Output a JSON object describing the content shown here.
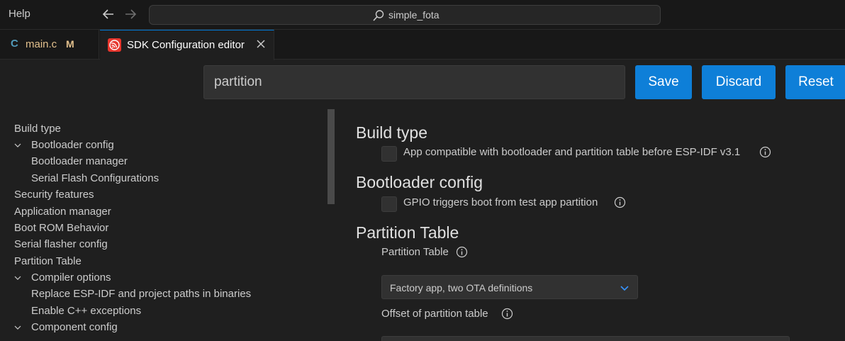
{
  "titlebar": {
    "menu_help": "Help",
    "command_center": "simple_fota"
  },
  "tabs": [
    {
      "lang_badge": "C",
      "label": "main.c",
      "status": "M"
    },
    {
      "label": "SDK Configuration editor"
    }
  ],
  "toolbar": {
    "search_value": "partition",
    "save_label": "Save",
    "discard_label": "Discard",
    "reset_label": "Reset"
  },
  "sidebar": {
    "items": [
      {
        "label": "Build type"
      },
      {
        "label": "Bootloader config"
      },
      {
        "label": "Bootloader manager"
      },
      {
        "label": "Serial Flash Configurations"
      },
      {
        "label": "Security features"
      },
      {
        "label": "Application manager"
      },
      {
        "label": "Boot ROM Behavior"
      },
      {
        "label": "Serial flasher config"
      },
      {
        "label": "Partition Table"
      },
      {
        "label": "Compiler options"
      },
      {
        "label": "Replace ESP-IDF and project paths in binaries"
      },
      {
        "label": "Enable C++ exceptions"
      },
      {
        "label": "Component config"
      }
    ]
  },
  "content": {
    "sections": [
      {
        "title": "Build type",
        "option": "App compatible with bootloader and partition table before ESP-IDF v3.1"
      },
      {
        "title": "Bootloader config",
        "option": "GPIO triggers boot from test app partition"
      },
      {
        "title": "Partition Table",
        "field_label": "Partition Table",
        "select_value": "Factory app, two OTA definitions",
        "offset_label": "Offset of partition table"
      }
    ]
  },
  "colors": {
    "accent": "#0e7fd8",
    "background": "#1f1f1f",
    "modified": "#e2c08d"
  }
}
